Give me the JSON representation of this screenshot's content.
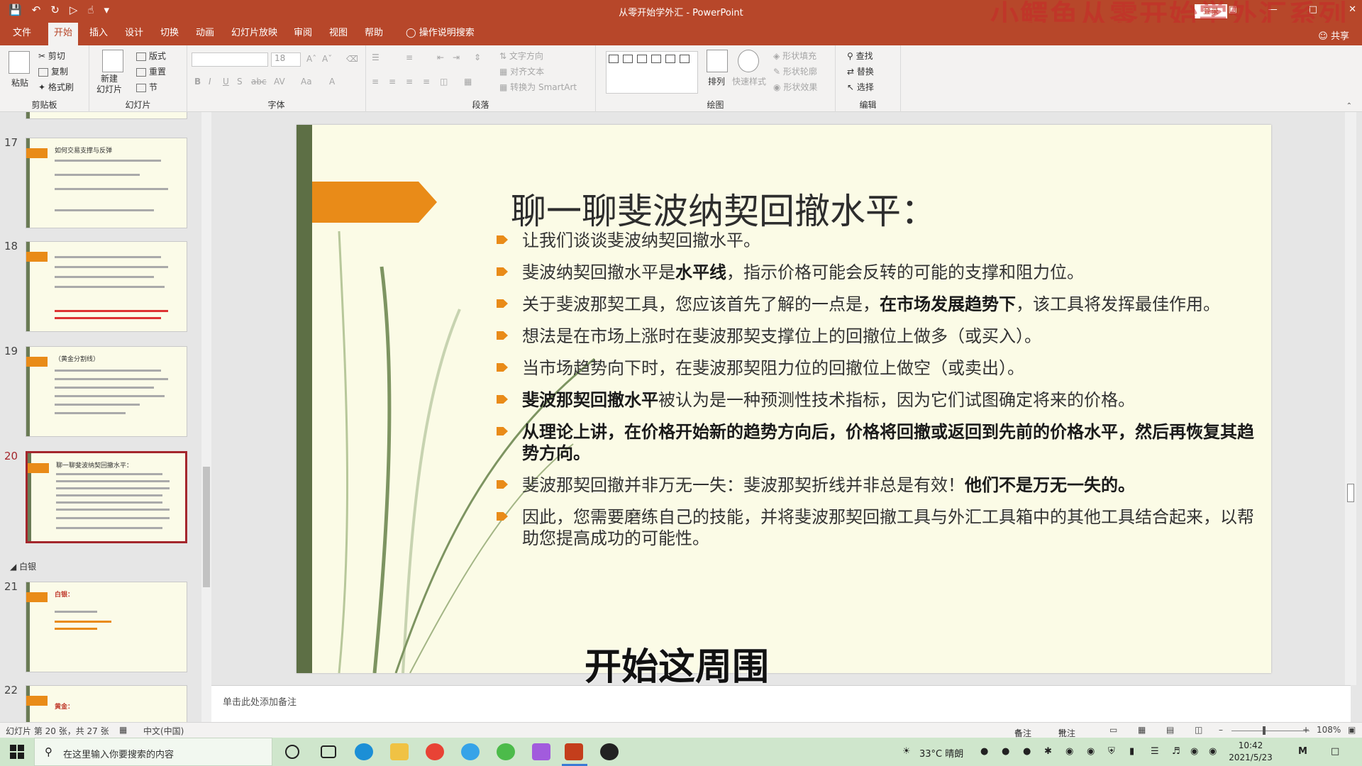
{
  "window": {
    "title": "从零开始学外汇 - PowerPoint",
    "watermark": "小鳄鱼从零开始学外汇系列",
    "login": "登录",
    "accent": "#b7472a"
  },
  "menu": {
    "tabs": [
      "文件",
      "开始",
      "插入",
      "设计",
      "切换",
      "动画",
      "幻灯片放映",
      "审阅",
      "视图",
      "帮助"
    ],
    "tell_me": "操作说明搜索",
    "share": "共享"
  },
  "ribbon": {
    "clipboard": {
      "label": "剪贴板",
      "paste": "粘贴",
      "cut": "剪切",
      "copy": "复制",
      "format_painter": "格式刷"
    },
    "slides": {
      "label": "幻灯片",
      "new_slide": "新建\n幻灯片",
      "layout": "版式",
      "reset": "重置",
      "section": "节"
    },
    "font": {
      "label": "字体",
      "size": "18"
    },
    "paragraph": {
      "label": "段落",
      "text_direction": "文字方向",
      "align_text": "对齐文本",
      "smartart": "转换为 SmartArt"
    },
    "drawing": {
      "label": "绘图",
      "arrange": "排列",
      "quick_styles": "快速样式",
      "shape_fill": "形状填充",
      "shape_outline": "形状轮廓",
      "shape_effects": "形状效果"
    },
    "editing": {
      "label": "编辑",
      "find": "查找",
      "replace": "替换",
      "select": "选择"
    }
  },
  "thumbnails": {
    "items": [
      {
        "num": "17",
        "title": "如何交易支撑与反弹"
      },
      {
        "num": "18",
        "title": ""
      },
      {
        "num": "19",
        "title": "（黄金分割线）"
      },
      {
        "num": "20",
        "title": "聊一聊斐波纳契回撤水平："
      },
      {
        "num": "21",
        "title": "白银："
      },
      {
        "num": "22",
        "title": "黄金："
      }
    ],
    "section": "白银"
  },
  "slide": {
    "title": "聊一聊斐波纳契回撤水平：",
    "bullets": [
      {
        "plain1": "让我们谈谈斐波纳契回撤水平。",
        "bold1": "",
        "plain2": "",
        "bold2": ""
      },
      {
        "plain1": "斐波纳契回撤水平是",
        "bold1": "水平线",
        "plain2": "，指示价格可能会反转的可能的支撑和阻力位。",
        "bold2": ""
      },
      {
        "plain1": "关于斐波那契工具，您应该首先了解的一点是，",
        "bold1": "在市场发展趋势下",
        "plain2": "，该工具将发挥最佳作用。",
        "bold2": ""
      },
      {
        "plain1": "想法是在市场上涨时在斐波那契支撑位上的回撤位上做多（或买入）。",
        "bold1": "",
        "plain2": "",
        "bold2": ""
      },
      {
        "plain1": "当市场趋势向下时，在斐波那契阻力位的回撤位上做空（或卖出）。",
        "bold1": "",
        "plain2": "",
        "bold2": ""
      },
      {
        "plain1": "",
        "bold1": "斐波那契回撤水平",
        "plain2": "被认为是一种预测性技术指标，因为它们试图确定将来的价格。",
        "bold2": ""
      },
      {
        "plain1": "",
        "bold1": "从理论上讲，在价格开始新的趋势方向后，价格将",
        "plain2": "",
        "bold2": "回撤或返回到先前的价格水平，然后再恢复其趋势方向。"
      },
      {
        "plain1": "斐波那契回撤并非万无一失：斐波那契折线并非总是有效！",
        "bold1": "他们不是万无一失的。",
        "plain2": "",
        "bold2": ""
      },
      {
        "plain1": "因此，您需要磨练自己的技能，并将斐波那契回撤工具与外汇工具箱中的其他工具结合起来，以帮助您提高成功的可能性。",
        "bold1": "",
        "plain2": "",
        "bold2": ""
      }
    ],
    "caption": "开始这周围",
    "colors": {
      "arrow": "#e98b18",
      "bar": "#5d6f45",
      "background": "#fbfbe6"
    }
  },
  "notes": {
    "placeholder": "单击此处添加备注"
  },
  "status": {
    "slide_info": "幻灯片 第 20 张，共 27 张",
    "language": "中文(中国)",
    "notes": "备注",
    "comments": "批注",
    "zoom": "108%"
  },
  "taskbar": {
    "search_placeholder": "在这里输入你要搜索的内容",
    "weather": "33°C  晴朗",
    "time": "10:42",
    "date": "2021/5/23"
  }
}
